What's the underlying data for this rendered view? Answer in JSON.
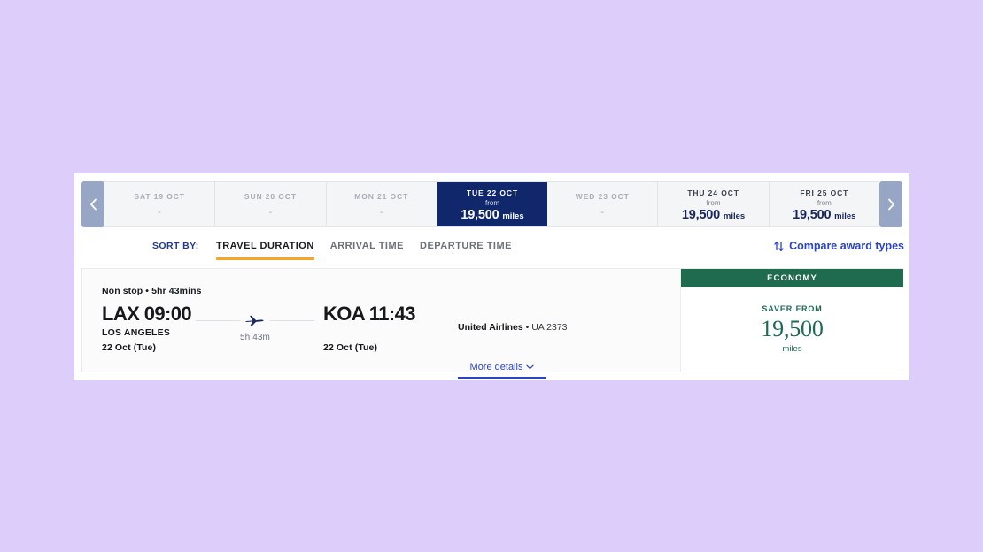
{
  "colors": {
    "page_background": "#dccdfb",
    "selected_date": "#10276b",
    "navy_text": "#17265c",
    "accent_underline": "#f5a623",
    "link_blue": "#2a43c7",
    "economy_green": "#1f6b4f",
    "nav_arrow": "#97a6c4"
  },
  "date_carousel": {
    "prev_icon": "chevron-left-icon",
    "next_icon": "chevron-right-icon",
    "dates": [
      {
        "day": "SAT 19 OCT",
        "from_label": "",
        "price": "",
        "unit": "",
        "dash": "-",
        "state": "empty"
      },
      {
        "day": "SUN 20 OCT",
        "from_label": "",
        "price": "",
        "unit": "",
        "dash": "-",
        "state": "empty"
      },
      {
        "day": "MON 21 OCT",
        "from_label": "",
        "price": "",
        "unit": "",
        "dash": "-",
        "state": "empty"
      },
      {
        "day": "TUE 22 OCT",
        "from_label": "from",
        "price": "19,500",
        "unit": "miles",
        "dash": "",
        "state": "selected"
      },
      {
        "day": "WED 23 OCT",
        "from_label": "",
        "price": "",
        "unit": "",
        "dash": "-",
        "state": "empty"
      },
      {
        "day": "THU 24 OCT",
        "from_label": "from",
        "price": "19,500",
        "unit": "miles",
        "dash": "",
        "state": "available"
      },
      {
        "day": "FRI 25 OCT",
        "from_label": "from",
        "price": "19,500",
        "unit": "miles",
        "dash": "",
        "state": "available"
      }
    ]
  },
  "sort": {
    "label": "SORT BY:",
    "tabs": [
      {
        "label": "TRAVEL DURATION",
        "active": true
      },
      {
        "label": "ARRIVAL TIME",
        "active": false
      },
      {
        "label": "DEPARTURE TIME",
        "active": false
      }
    ],
    "compare": {
      "label": "Compare award types",
      "icon": "sort-swap-icon"
    }
  },
  "flight": {
    "stops_summary": "Non stop • 5hr 43mins",
    "origin": {
      "code_time": "LAX 09:00",
      "city": "LOS ANGELES",
      "date": "22 Oct (Tue)"
    },
    "destination": {
      "code_time": "KOA 11:43",
      "date": "22 Oct (Tue)"
    },
    "route": {
      "duration": "5h 43m",
      "icon": "airplane-icon"
    },
    "airline_name": "United Airlines",
    "flight_number": " • UA 2373",
    "more_details": {
      "label": "More details",
      "icon": "chevron-down-icon"
    },
    "fare": {
      "cabin": "ECONOMY",
      "saver_label": "SAVER FROM",
      "amount": "19,500",
      "unit": "miles"
    }
  }
}
